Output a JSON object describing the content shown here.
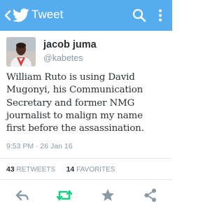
{
  "appbar": {
    "title": "Tweet",
    "icons": [
      "back-arrow-icon",
      "twitter-bird-icon",
      "search-icon",
      "overflow-menu-icon"
    ],
    "color": "#55acee"
  },
  "tweet": {
    "author_name": "jacob juma",
    "author_handle": "@kabetes",
    "text_lines": [
      "William Ruto is using David",
      "Mugonyi, his Communication",
      "Secretary and former NMG",
      "journalist to malign my name",
      "first before the assassination."
    ],
    "timestamp": "9:53 PM · 26 Jan 16",
    "retweets_count": "43",
    "retweets_label": "RETWEETS",
    "favorites_count": "14",
    "favorites_label": "FAVORITES"
  },
  "actions": {
    "icons": [
      "reply-icon",
      "retweet-icon",
      "favorite-star-icon",
      "share-icon"
    ],
    "retweet_active_color": "#19cf86",
    "icon_color": "#8899a6"
  }
}
